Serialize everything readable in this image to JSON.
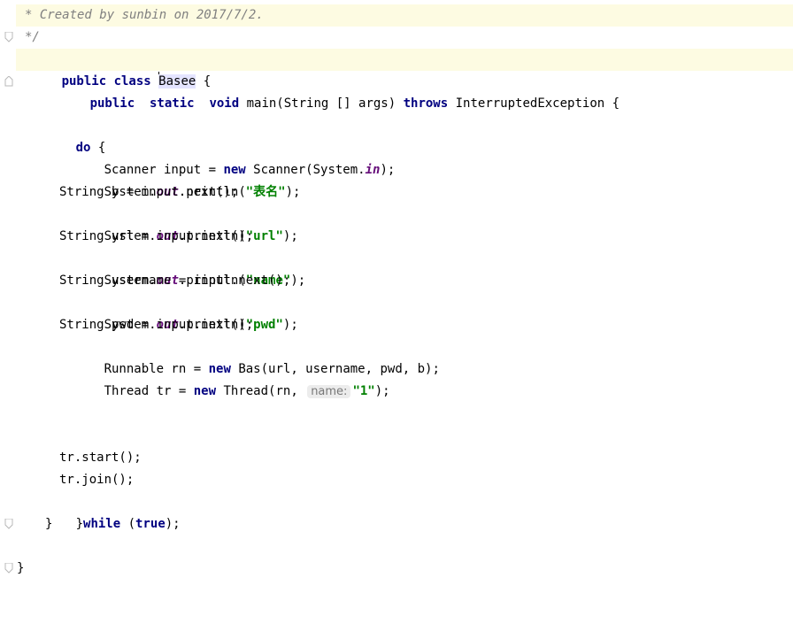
{
  "editor": {
    "lines": {
      "comment_created": "* Created by sunbin on 2017/7/2.",
      "comment_end": "*/",
      "class_kw": "public class",
      "class_name": "Basee",
      "class_brace": " {",
      "main_kw": "public  static  void",
      "main_sig": " main(String [] args) ",
      "main_throws": "throws",
      "main_exc": " InterruptedException {",
      "do_kw": "do",
      "do_brace": " {",
      "scanner_a": "Scanner input = ",
      "scanner_new": "new",
      "scanner_b": " Scanner(System.",
      "scanner_in": "in",
      "scanner_c": ");",
      "p1_a": "System.",
      "p1_out": "out",
      "p1_b": ".println(",
      "p1_str": "\"表名\"",
      "p1_c": ");",
      "b_line": "String b = input.next();",
      "p2_a": "System.",
      "p2_out": "out",
      "p2_b": ".println(",
      "p2_str": "\"url\"",
      "p2_c": ");",
      "url_line": "String url = input.next();",
      "p3_a": "System.",
      "p3_out": "out",
      "p3_b": ".println(",
      "p3_str": "\"name\"",
      "p3_c": ");",
      "username_line": "String username = input.next();",
      "p4_a": "System.",
      "p4_out": "out",
      "p4_b": ".println(",
      "p4_str": "\"pwd\"",
      "p4_c": ");",
      "pwd_line": "String pwd = input.next();",
      "rn_a": "Runnable rn = ",
      "rn_new": "new",
      "rn_b": " Bas(url, username, pwd, b);",
      "tr_a": "Thread tr = ",
      "tr_new": "new",
      "tr_b": " Thread(rn, ",
      "tr_hint": "name:",
      "tr_str": "\"1\"",
      "tr_c": ");",
      "start_line": "tr.start();",
      "join_line": "tr.join();",
      "while_brace": "}",
      "while_kw": "while",
      "while_b": " (",
      "while_true": "true",
      "while_c": ");",
      "close_main": "}",
      "close_class": "}"
    }
  }
}
